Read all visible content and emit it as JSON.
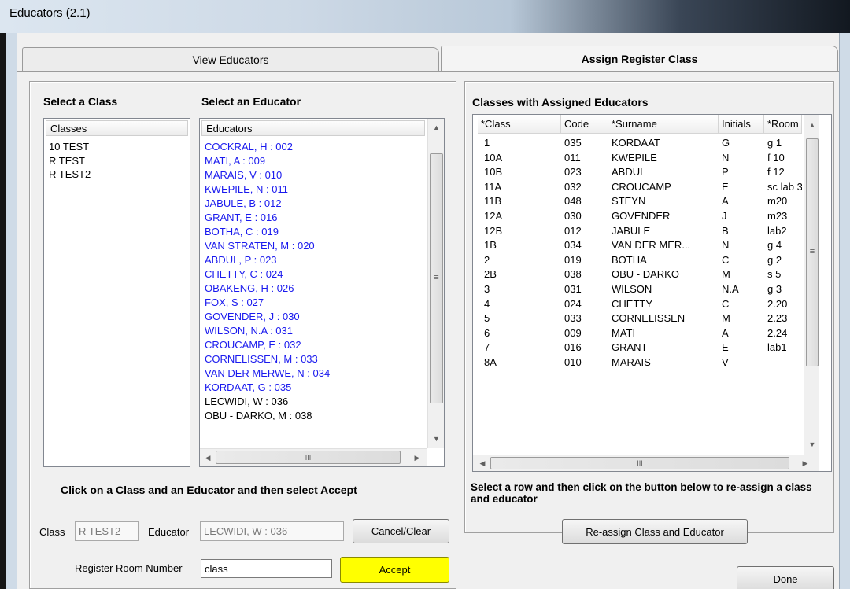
{
  "window": {
    "title": "Educators (2.1)"
  },
  "tabs": [
    {
      "label": "View Educators"
    },
    {
      "label": "Assign Register Class"
    }
  ],
  "left": {
    "class_heading": "Select a Class",
    "educator_heading": "Select an Educator",
    "classes_header": "Classes",
    "classes": [
      "10 TEST",
      "R TEST",
      "R TEST2"
    ],
    "educators_header": "Educators",
    "educators": [
      "COCKRAL, H : 002",
      "MATI, A  : 009",
      "MARAIS, V : 010",
      "KWEPILE, N : 011",
      "JABULE, B : 012",
      "GRANT, E : 016",
      "BOTHA, C : 019",
      "VAN STRATEN, M : 020",
      "ABDUL, P : 023",
      "CHETTY, C : 024",
      "OBAKENG, H : 026",
      "FOX, S : 027",
      "GOVENDER, J : 030",
      "WILSON, N.A : 031",
      "CROUCAMP, E : 032",
      "CORNELISSEN, M : 033",
      "VAN DER MERWE, N : 034",
      "KORDAAT, G : 035",
      "LECWIDI, W : 036",
      "OBU - DARKO, M : 038"
    ],
    "instruction": "Click on a Class and an Educator and then select Accept",
    "class_label": "Class",
    "class_value": "R TEST2",
    "educator_label": "Educator",
    "educator_value": "LECWIDI, W : 036",
    "cancel_label": "Cancel/Clear",
    "room_label": "Register Room Number",
    "room_value": "class",
    "accept_label": "Accept"
  },
  "right": {
    "heading": "Classes with Assigned Educators",
    "columns": [
      "*Class",
      "Code",
      "*Surname",
      "Initials",
      "*Room"
    ],
    "rows": [
      [
        "1",
        "035",
        "KORDAAT",
        "G",
        "g 1"
      ],
      [
        "10A",
        "011",
        "KWEPILE",
        "N",
        "f 10"
      ],
      [
        "10B",
        "023",
        "ABDUL",
        "P",
        "f 12"
      ],
      [
        "11A",
        "032",
        "CROUCAMP",
        "E",
        "sc lab 3"
      ],
      [
        "11B",
        "048",
        "STEYN",
        "A",
        "m20"
      ],
      [
        "12A",
        "030",
        "GOVENDER",
        "J",
        "m23"
      ],
      [
        "12B",
        "012",
        "JABULE",
        "B",
        "lab2"
      ],
      [
        "1B",
        "034",
        "VAN DER MER...",
        "N",
        "g 4"
      ],
      [
        "2",
        "019",
        "BOTHA",
        "C",
        "g 2"
      ],
      [
        "2B",
        "038",
        "OBU - DARKO",
        "M",
        "s 5"
      ],
      [
        "3",
        "031",
        "WILSON",
        "N.A",
        "g 3"
      ],
      [
        "4",
        "024",
        "CHETTY",
        "C",
        "2.20"
      ],
      [
        "5",
        "033",
        "CORNELISSEN",
        "M",
        "2.23"
      ],
      [
        "6",
        "009",
        "MATI",
        "A",
        "2.24"
      ],
      [
        "7",
        "016",
        "GRANT",
        "E",
        "lab1"
      ],
      [
        "8A",
        "010",
        "MARAIS",
        "V",
        ""
      ]
    ],
    "instruction": "Select a row and then click on the button below to re-assign a class and educator",
    "reassign_label": "Re-assign Class and Educator"
  },
  "done_label": "Done",
  "icons": {
    "scroll_up": "▲",
    "scroll_down": "▼",
    "scroll_left": "◀",
    "scroll_right": "▶",
    "grip": "≡",
    "hgrip": "III"
  },
  "colors": {
    "educator_link": "#1a1aee",
    "accept_bg": "#ffff00"
  }
}
